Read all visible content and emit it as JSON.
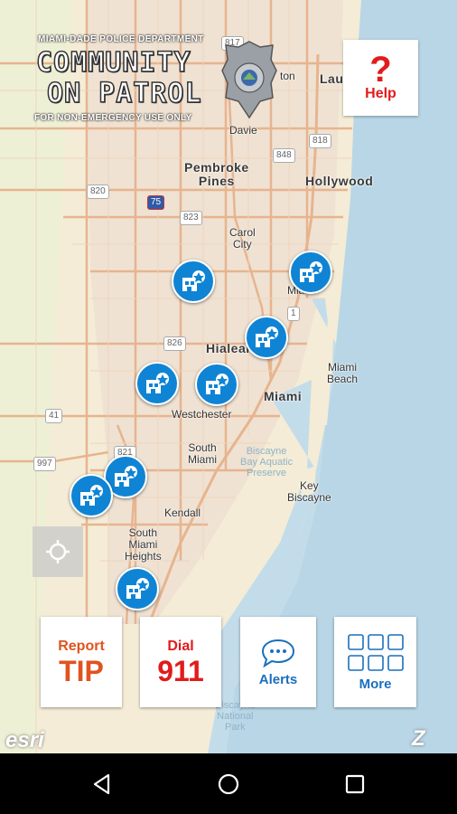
{
  "map": {
    "labels": {
      "lauderdale": "Lau",
      "davie": "Davie",
      "pembroke_pines": "Pembroke\nPines",
      "hollywood": "Hollywood",
      "carol_city": "Carol\nCity",
      "miami_gardens": "Miami",
      "hialeah": "Hialeah",
      "miami_beach": "Miami\nBeach",
      "miami": "Miami",
      "westchester": "Westchester",
      "south_miami": "South\nMiami",
      "biscayne_park": "Biscayne\nBay Aquatic\nPreserve",
      "key_biscayne": "Key\nBiscayne",
      "kendall": "Kendall",
      "south_miami_heights": "South\nMiami\nHeights",
      "national_park": "Biscayne\nNational\nPark",
      "ton": "ton"
    },
    "shields": {
      "s817": "817",
      "s818": "818",
      "s848": "848",
      "s820": "820",
      "s75": "75",
      "s823": "823",
      "s1": "1",
      "s826": "826",
      "s41": "41",
      "s997": "997",
      "s821": "821"
    },
    "marker_icon": "police-station-icon"
  },
  "banner": {
    "department": "MIAMI-DADE POLICE DEPARTMENT",
    "title_line1": "COMMUNITY",
    "title_line2": "ON PATROL",
    "subtitle": "FOR NON-EMERGENCY USE ONLY",
    "badge_icon": "police-badge-icon"
  },
  "help": {
    "glyph": "?",
    "label": "Help"
  },
  "locate": {
    "icon": "crosshair-icon"
  },
  "actions": {
    "report": {
      "line1": "Report",
      "line2": "TIP"
    },
    "dial": {
      "line1": "Dial",
      "line2": "911"
    },
    "alerts": {
      "label": "Alerts",
      "icon": "chat-bubble-icon"
    },
    "more": {
      "label": "More",
      "icon": "grid-icon"
    }
  },
  "attribution": {
    "esri": "esri",
    "brand": "Z"
  },
  "colors": {
    "accent_blue": "#1a6fbe",
    "marker_blue": "#0f84d4",
    "report_orange": "#e0531f",
    "dial_red": "#e21b1b",
    "land": "#f4ecd6",
    "water": "#b9d6e6",
    "road": "#e7b48f"
  },
  "navbar": {
    "back_icon": "back-triangle-icon",
    "home_icon": "home-circle-icon",
    "recents_icon": "recents-square-icon"
  }
}
